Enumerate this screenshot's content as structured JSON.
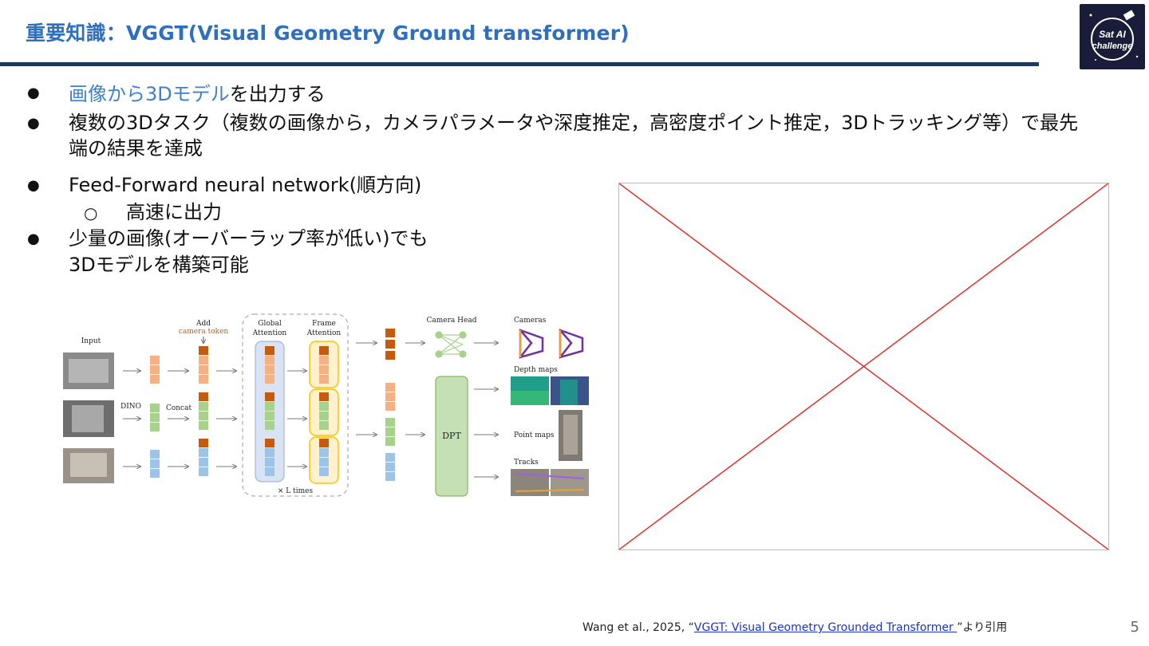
{
  "title": "重要知識：VGGT(Visual Geometry Ground transformer)",
  "logo_text": "Sat AI challenge",
  "bullets": {
    "b1_highlight": "画像から3Dモデル",
    "b1_rest": "を出力する",
    "b2_line1": "複数の3Dタスク（複数の画像から，カメラパラメータや深度推定，高密度ポイント推定，3Dトラッキング等）で最先",
    "b2_line2": "端の結果を達成",
    "b3": "Feed-Forward neural network(順方向)",
    "b3_sub": "高速に出力",
    "b4_line1": "少量の画像(オーバーラップ率が低い)でも",
    "b4_line2": "3Dモデルを構築可能",
    "bullet_glyph": "●",
    "sub_glyph": "○"
  },
  "diagram": {
    "input": "Input",
    "dino": "DINO",
    "concat": "Concat",
    "add": "Add",
    "camera_token": "camera token",
    "global_attention_1": "Global",
    "global_attention_2": "Attention",
    "frame_attention_1": "Frame",
    "frame_attention_2": "Attention",
    "times": "× L times",
    "camera_head": "Camera Head",
    "dpt": "DPT",
    "cameras": "Cameras",
    "depth_maps": "Depth maps",
    "point_maps": "Point maps",
    "tracks": "Tracks",
    "colors": {
      "orange_token": "#c55a11",
      "light_orange": "#f4b183",
      "green": "#a9d18e",
      "blue": "#9dc3e6",
      "global_box": "#dae3f3",
      "frame_box": "#fff2cc",
      "frame_border": "#ffc000",
      "dpt_fill": "#c5e0b4",
      "dpt_border": "#70ad47",
      "camera_purple": "#7030a0"
    }
  },
  "citation": {
    "prefix": "Wang et al., 2025, “",
    "link": "VGGT: Visual Geometry Grounded Transformer ",
    "suffix": "”より引用"
  },
  "page_number": "5",
  "colors": {
    "title": "#2f6fbf",
    "rule": "#1f3a5f",
    "placeholder_cross": "#e03030"
  }
}
